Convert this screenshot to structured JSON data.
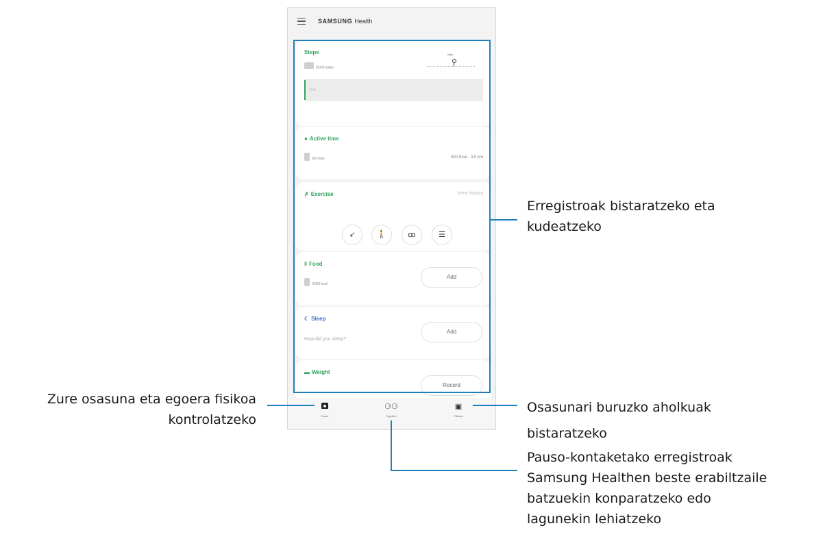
{
  "app": {
    "title_brand": "SAMSUNG",
    "title_suffix": "Health"
  },
  "cards": {
    "steps": {
      "title": "Steps",
      "goal": "/6000 steps",
      "pin_label": "Now",
      "bar_text": "0 %"
    },
    "active_time": {
      "title": "Active time",
      "goal": "/60 mins",
      "stats": "502 Kcal · 0.0 km"
    },
    "exercise": {
      "title": "Exercise",
      "view_history": "View history"
    },
    "food": {
      "title": "Food",
      "goal": "/1966 kcal",
      "add": "Add"
    },
    "sleep": {
      "title": "Sleep",
      "question": "How did you sleep?",
      "add": "Add"
    },
    "weight": {
      "title": "Weight",
      "record": "Record"
    }
  },
  "nav": {
    "home": "Home",
    "together": "Together",
    "fitness": "Fitness"
  },
  "callouts": {
    "records": [
      "Erregistroak bistaratzeko eta",
      "kudeatzeko"
    ],
    "home": [
      "Zure osasuna eta egoera fisikoa",
      "kontrolatzeko"
    ],
    "fitness": [
      "Osasunari buruzko aholkuak",
      "bistaratzeko"
    ],
    "together": [
      "Pauso-kontaketako erregistroak",
      "Samsung Healthen beste erabiltzaile",
      "batzuekin konparatzeko edo",
      "lagunekin lehiatzeko"
    ]
  },
  "colors": {
    "accent_green": "#2fa35b",
    "callout_blue": "#1f7fb8",
    "sleep_blue": "#3b6fc6"
  },
  "icons": [
    "menu-icon",
    "steps-pin-icon",
    "active-time-icon",
    "run-icon",
    "walk-icon",
    "bike-icon",
    "list-icon",
    "food-icon",
    "sleep-icon",
    "weight-icon",
    "home-icon",
    "together-icon",
    "fitness-icon"
  ]
}
